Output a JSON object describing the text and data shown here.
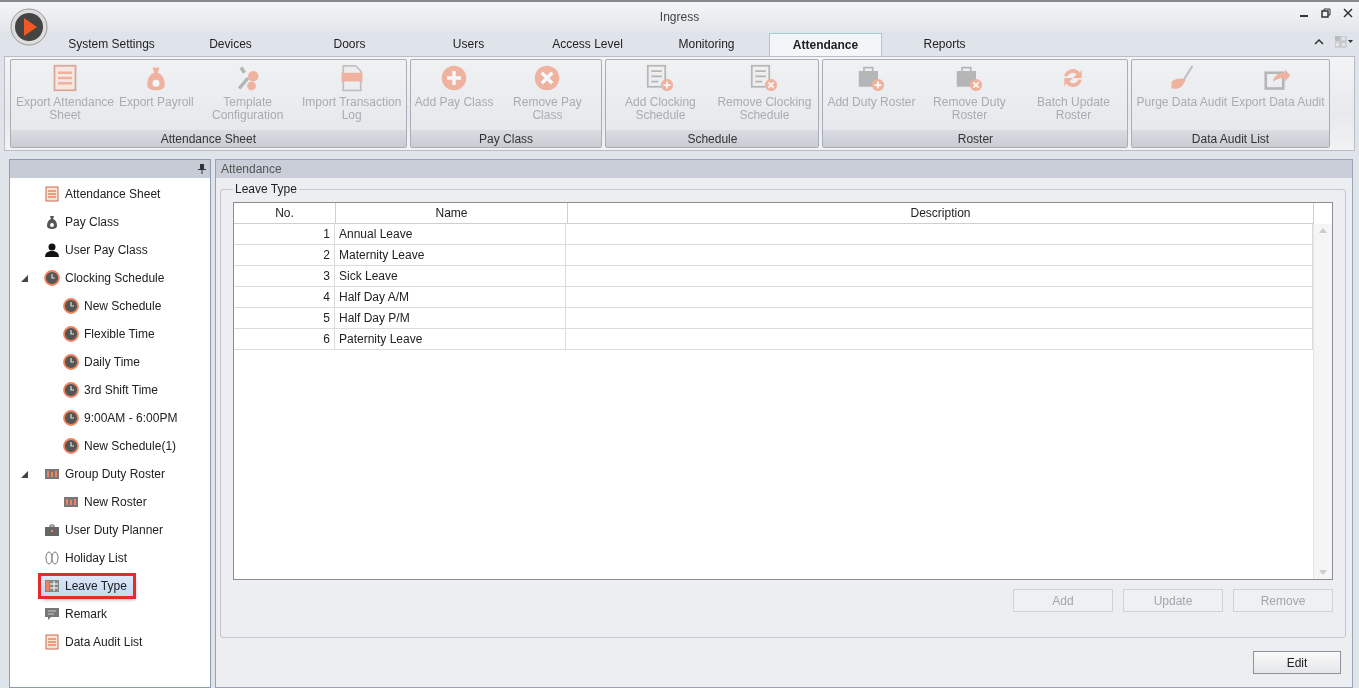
{
  "window": {
    "title": "Ingress"
  },
  "tabs": [
    {
      "label": "System Settings",
      "selected": false
    },
    {
      "label": "Devices",
      "selected": false
    },
    {
      "label": "Doors",
      "selected": false
    },
    {
      "label": "Users",
      "selected": false
    },
    {
      "label": "Access Level",
      "selected": false
    },
    {
      "label": "Monitoring",
      "selected": false
    },
    {
      "label": "Attendance",
      "selected": true
    },
    {
      "label": "Reports",
      "selected": false
    }
  ],
  "ribbon": {
    "groups": [
      {
        "label": "Attendance Sheet",
        "buttons": [
          {
            "label": "Export Attendance Sheet",
            "kind": "sheet",
            "disabled": true
          },
          {
            "label": "Export Payroll",
            "kind": "moneybag",
            "disabled": true
          },
          {
            "label": "Template Configuration",
            "kind": "gears",
            "disabled": true
          },
          {
            "label": "Import Transaction Log",
            "kind": "log",
            "disabled": true
          }
        ]
      },
      {
        "label": "Pay Class",
        "buttons": [
          {
            "label": "Add Pay Class",
            "kind": "plus",
            "disabled": true
          },
          {
            "label": "Remove Pay Class",
            "kind": "cross",
            "disabled": true
          }
        ]
      },
      {
        "label": "Schedule",
        "buttons": [
          {
            "label": "Add Clocking Schedule",
            "kind": "docadd",
            "disabled": true
          },
          {
            "label": "Remove Clocking Schedule",
            "kind": "docremove",
            "disabled": true
          }
        ]
      },
      {
        "label": "Roster",
        "buttons": [
          {
            "label": "Add Duty Roster",
            "kind": "caseadd",
            "disabled": true
          },
          {
            "label": "Remove Duty Roster",
            "kind": "caseremove",
            "disabled": true
          },
          {
            "label": "Batch Update Roster",
            "kind": "refresh",
            "disabled": true
          }
        ]
      },
      {
        "label": "Data Audit List",
        "buttons": [
          {
            "label": "Purge Data Audit",
            "kind": "broom",
            "disabled": true
          },
          {
            "label": "Export Data Audit",
            "kind": "export",
            "disabled": true
          }
        ]
      }
    ]
  },
  "sidebar": {
    "items": [
      {
        "label": "Attendance Sheet",
        "kind": "sheet",
        "selected": false
      },
      {
        "label": "Pay Class",
        "kind": "moneybag",
        "selected": false
      },
      {
        "label": "User Pay Class",
        "kind": "user",
        "selected": false
      },
      {
        "label": "Clocking Schedule",
        "kind": "clock",
        "selected": false,
        "expanded": true,
        "children": [
          {
            "label": "New Schedule",
            "kind": "clock",
            "selected": false
          },
          {
            "label": "Flexible Time",
            "kind": "clock",
            "selected": false
          },
          {
            "label": "Daily Time",
            "kind": "clock",
            "selected": false
          },
          {
            "label": "3rd Shift Time",
            "kind": "clock",
            "selected": false
          },
          {
            "label": "9:00AM - 6:00PM",
            "kind": "clock",
            "selected": false
          },
          {
            "label": "New Schedule(1)",
            "kind": "clock",
            "selected": false
          }
        ]
      },
      {
        "label": "Group Duty Roster",
        "kind": "roster",
        "selected": false,
        "expanded": true,
        "children": [
          {
            "label": "New Roster",
            "kind": "roster",
            "selected": false
          }
        ]
      },
      {
        "label": "User Duty Planner",
        "kind": "briefcase",
        "selected": false
      },
      {
        "label": "Holiday List",
        "kind": "sandals",
        "selected": false
      },
      {
        "label": "Leave Type",
        "kind": "grid",
        "selected": true
      },
      {
        "label": "Remark",
        "kind": "comment",
        "selected": false
      },
      {
        "label": "Data Audit List",
        "kind": "sheet",
        "selected": false
      }
    ]
  },
  "panel": {
    "title": "Attendance",
    "group_title": "Leave Type",
    "table": {
      "columns": [
        "No.",
        "Name",
        "Description"
      ],
      "rows": [
        {
          "no": "1",
          "name": "Annual Leave"
        },
        {
          "no": "2",
          "name": "Maternity Leave"
        },
        {
          "no": "3",
          "name": "Sick Leave"
        },
        {
          "no": "4",
          "name": "Half Day A/M"
        },
        {
          "no": "5",
          "name": "Half Day P/M"
        },
        {
          "no": "6",
          "name": "Paternity Leave"
        }
      ]
    },
    "buttons": [
      {
        "label": "Add",
        "disabled": true
      },
      {
        "label": "Update",
        "disabled": true
      },
      {
        "label": "Remove",
        "disabled": true
      }
    ],
    "edit_button": {
      "label": "Edit",
      "disabled": false
    }
  }
}
